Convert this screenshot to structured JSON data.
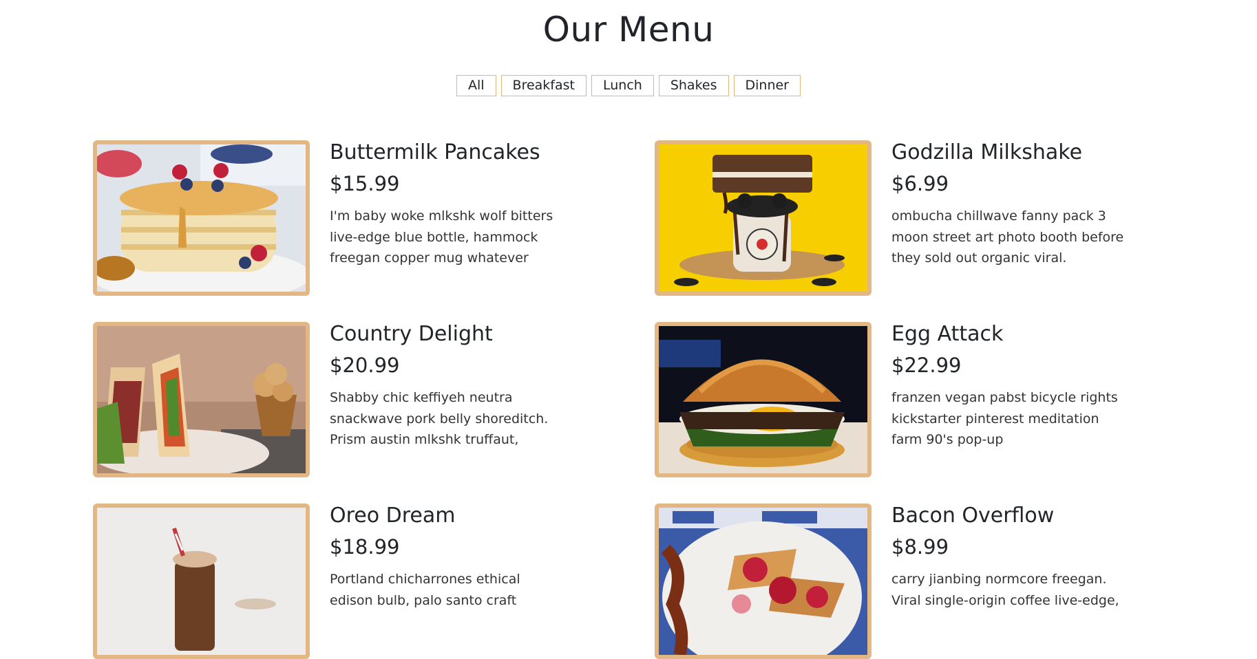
{
  "page_title": "Our Menu",
  "filters": [
    "All",
    "Breakfast",
    "Lunch",
    "Shakes",
    "Dinner"
  ],
  "items": [
    {
      "title": "Buttermilk Pancakes",
      "price": "$15.99",
      "desc": "I'm baby woke mlkshk wolf bitters live-edge blue bottle, hammock freegan copper mug whatever"
    },
    {
      "title": "Godzilla Milkshake",
      "price": "$6.99",
      "desc": "ombucha chillwave fanny pack 3 moon street art photo booth before they sold out organic viral."
    },
    {
      "title": "Country Delight",
      "price": "$20.99",
      "desc": "Shabby chic keffiyeh neutra snackwave pork belly shoreditch. Prism austin mlkshk truffaut,"
    },
    {
      "title": "Egg Attack",
      "price": "$22.99",
      "desc": "franzen vegan pabst bicycle rights kickstarter pinterest meditation farm 90's pop-up"
    },
    {
      "title": "Oreo Dream",
      "price": "$18.99",
      "desc": "Portland chicharrones ethical edison bulb, palo santo craft"
    },
    {
      "title": "Bacon Overflow",
      "price": "$8.99",
      "desc": "carry jianbing normcore freegan. Viral single-origin coffee live-edge,"
    }
  ]
}
